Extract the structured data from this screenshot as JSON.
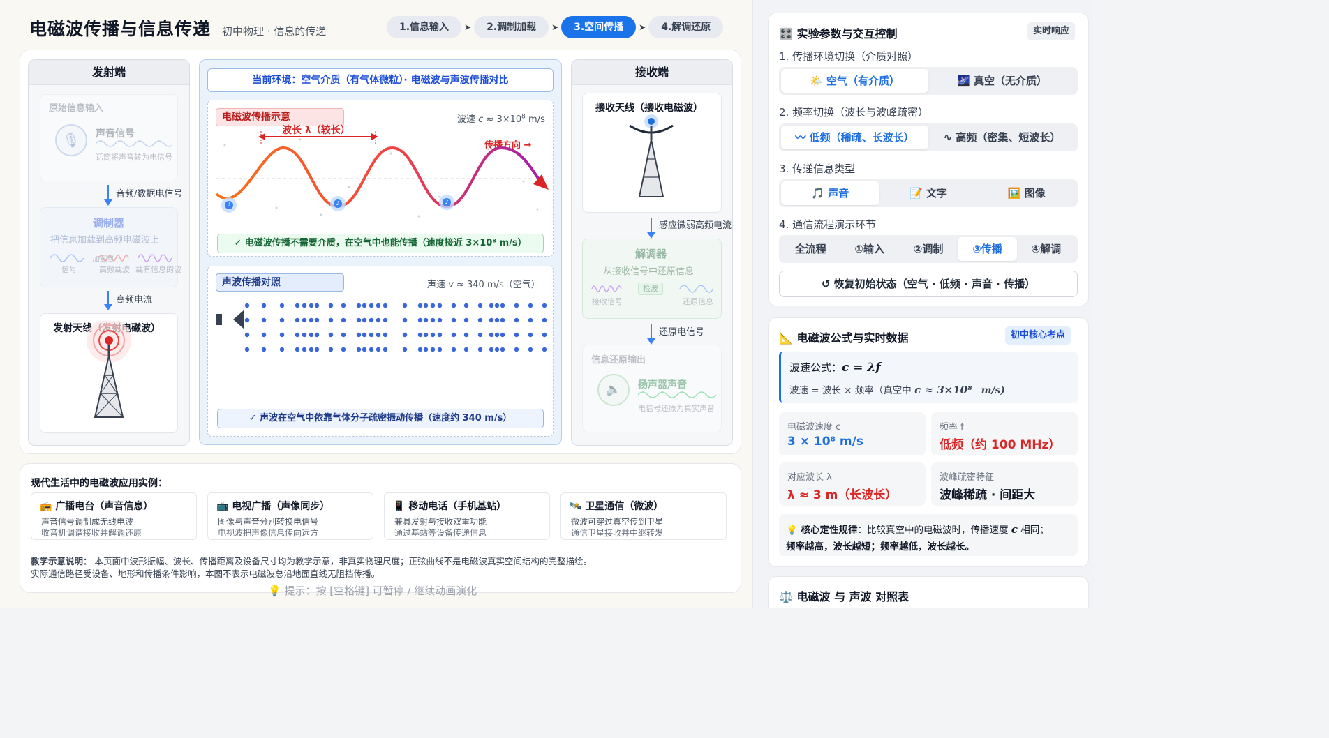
{
  "header": {
    "title": "电磁波传播与信息传递",
    "subtitle": "初中物理 · 信息的传递",
    "steps": [
      "1.信息输入",
      "2.调制加载",
      "3.空间传播",
      "4.解调还原"
    ],
    "active_step": 2
  },
  "transmitter": {
    "title": "发射端",
    "input_box_title": "原始信息输入",
    "input_signal_label": "声音信号",
    "input_signal_note": "话筒将声音转为电信号",
    "arrow1_label": "音频/数据电信号",
    "modulator_title": "调制器",
    "modulator_desc": "把信息加载到高频电磁波上",
    "modulator_plus": "加载到",
    "modulator_labels": [
      "信号",
      "高频载波",
      "载有信息的波"
    ],
    "arrow2_label": "高频电流",
    "antenna_label": "发射天线（发射电磁波）"
  },
  "center": {
    "env_banner": "当前环境：空气介质（有气体微粒）· 电磁波与声波传播对比",
    "em": {
      "tag": "电磁波传播示意",
      "speed_prefix": "波速 ",
      "speed_var": "c",
      "speed_mid": " ≈ 3×10",
      "speed_exp": "8",
      "speed_unit": " m/s",
      "wavelength_label": "波长 λ（较长）",
      "direction_label": "传播方向 →",
      "note_symbol": "♪",
      "note": "✓ 电磁波传播不需要介质，在空气中也能传播（速度接近 3×10⁸ m/s）"
    },
    "sound": {
      "tag": "声波传播对照",
      "speed_prefix": "声速 ",
      "speed_var": "v",
      "speed_rest": " ≈ 340 m/s（空气）",
      "note": "✓ 声波在空气中依靠气体分子疏密振动传播（速度约 340 m/s）"
    }
  },
  "receiver": {
    "title": "接收端",
    "antenna_label": "接收天线（接收电磁波）",
    "arrow1_label": "感应微弱高频电流",
    "demod_title": "解调器",
    "demod_desc": "从接收信号中还原信息",
    "demod_box": "检波",
    "demod_labels": [
      "接收信号",
      "还原信息"
    ],
    "arrow2_label": "还原电信号",
    "output_title": "信息还原输出",
    "speaker_label": "扬声器声音",
    "speaker_note": "电信号还原为真实声音"
  },
  "applications": {
    "heading": "现代生活中的电磁波应用实例：",
    "items": [
      {
        "icon": "radio-icon",
        "title": "广播电台（声音信息）",
        "line1": "声音信号调制成无线电波",
        "line2": "收音机调谐接收并解调还原"
      },
      {
        "icon": "tv-icon",
        "title": "电视广播（声像同步）",
        "line1": "图像与声音分别转换电信号",
        "line2": "电视波把声像信息传向远方"
      },
      {
        "icon": "phone-icon",
        "title": "移动电话（手机基站）",
        "line1": "兼具发射与接收双重功能",
        "line2": "通过基站等设备传递信息"
      },
      {
        "icon": "satellite-icon",
        "title": "卫星通信（微波）",
        "line1": "微波可穿过真空传到卫星",
        "line2": "通信卫星接收并中继转发"
      }
    ],
    "teaching_label": "教学示意说明：",
    "teaching_text1": "本页面中波形振幅、波长、传播距离及设备尺寸均为教学示意，非真实物理尺度；正弦曲线不是电磁波真实空间结构的完整描绘。",
    "teaching_text2": "实际通信路径受设备、地形和传播条件影响，本图不表示电磁波总沿地面直线无阻挡传播。",
    "hint": "💡 提示：按 [空格键] 可暂停 / 继续动画演化"
  },
  "controls": {
    "title": "🎛️ 实验参数与交互控制",
    "badge": "实时响应",
    "q1": "1. 传播环境切换（介质对照）",
    "env_options": [
      "🌤️ 空气（有介质）",
      "🌌 真空（无介质）"
    ],
    "env_selected": 0,
    "q2": "2. 频率切换（波长与波峰疏密）",
    "freq_options": [
      "〰 低频（稀疏、长波长）",
      "∿ 高频（密集、短波长）"
    ],
    "freq_selected": 0,
    "q3": "3. 传递信息类型",
    "info_options": [
      "🎵 声音",
      "📝 文字",
      "🖼️ 图像"
    ],
    "info_selected": 0,
    "q4": "4. 通信流程演示环节",
    "stage_options": [
      "全流程",
      "①输入",
      "②调制",
      "③传播",
      "④解调"
    ],
    "stage_selected": 3,
    "reset": "↺  恢复初始状态（空气 · 低频 · 声音 · 传播）"
  },
  "formula": {
    "title": "📐 电磁波公式与实时数据",
    "badge": "初中核心考点",
    "label": "波速公式：",
    "expr": "c = λf",
    "desc_prefix": "波速 = 波长 × 频率（真空中 ",
    "desc_expr": "c ≈ 3×10⁸",
    "desc_unit": "m/s)",
    "stats": [
      {
        "k": "电磁波速度 c",
        "v": "3 × 10⁸ m/s",
        "color": "#1d6fe0"
      },
      {
        "k": "频率 f",
        "v": "低频（约 100 MHz）",
        "color": "#dc2626"
      },
      {
        "k": "对应波长 λ",
        "v": "λ ≈ 3 m（长波长）",
        "color": "#dc2626"
      },
      {
        "k": "波峰疏密特征",
        "v": "波峰稀疏 · 间距大",
        "color": "#111827"
      }
    ],
    "rule_label": "💡 核心定性规律",
    "rule_text1": "：比较真空中的电磁波时，传播速度 ",
    "rule_var": "c",
    "rule_text2": " 相同；",
    "rule_line2": "频率越高，波长越短；频率越低，波长越长。"
  },
  "compare": {
    "title": "⚖️ 电磁波 与 声波 对照表"
  }
}
